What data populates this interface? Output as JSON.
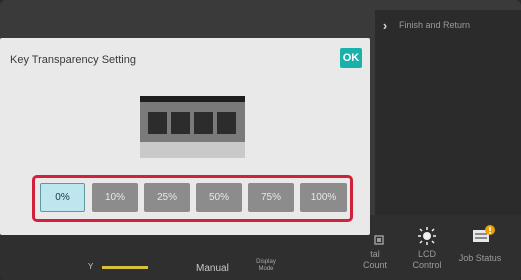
{
  "dialog": {
    "title": "Key Transparency Setting",
    "ok_label": "OK",
    "options": [
      "0%",
      "10%",
      "25%",
      "50%",
      "75%",
      "100%"
    ],
    "selected_option": "0%"
  },
  "right_panel": {
    "finish_label": "Finish and Return"
  },
  "bottom_bar": {
    "y_label": "Y",
    "manual_label": "Manual",
    "display_mode_label": "Display\nMode",
    "count_label": "tal\nCount",
    "lcd_label": "LCD\nControl",
    "job_status_label": "Job Status"
  },
  "colors": {
    "ok": "#19b2aa",
    "highlight_frame": "#d0203a",
    "selected_option": "#bde6ef"
  }
}
